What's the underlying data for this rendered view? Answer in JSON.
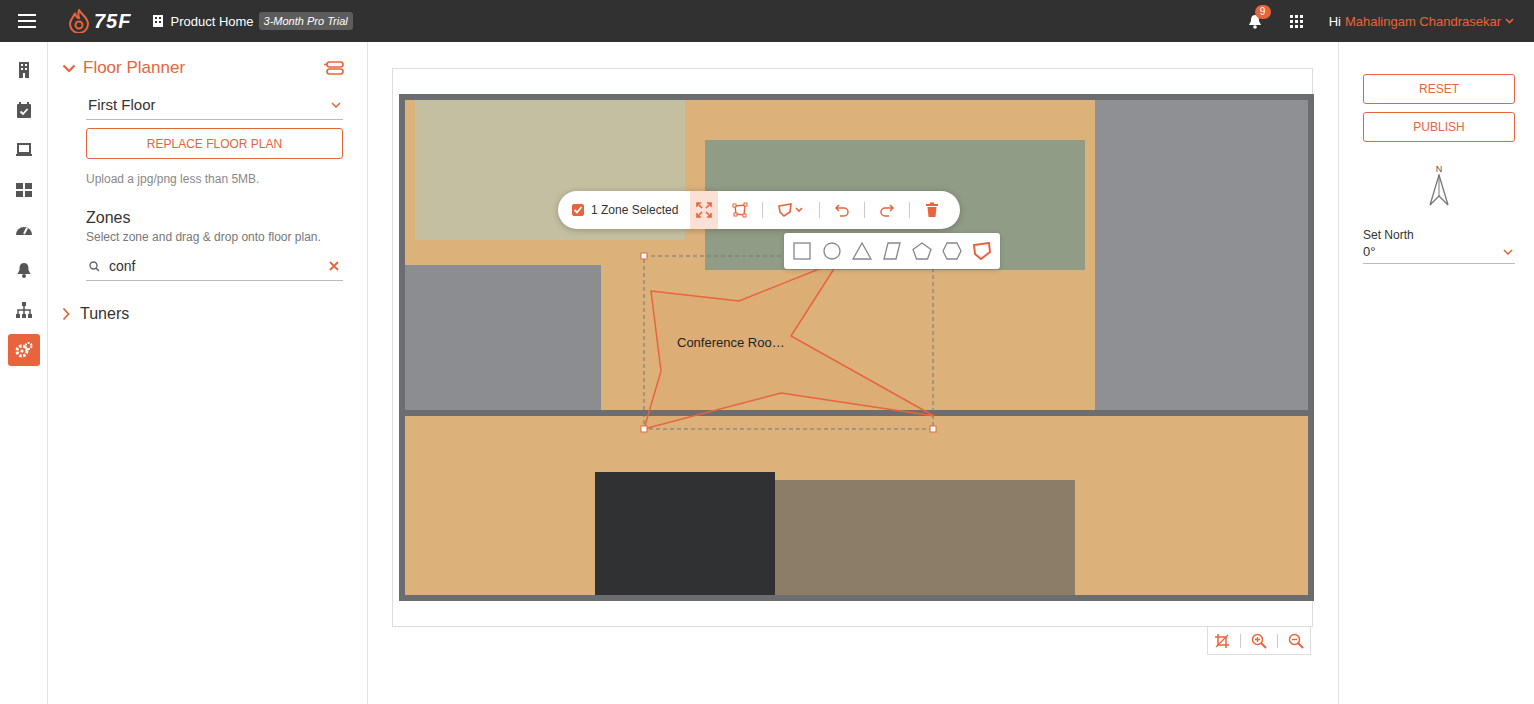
{
  "topbar": {
    "logo": "75F",
    "breadcrumb": "Product Home",
    "trial_badge": "3-Month Pro Trial",
    "notifications": "9",
    "greeting": "Hi",
    "user": "Mahalingam Chandrasekar"
  },
  "rail": [
    {
      "kind": "building",
      "selected": false
    },
    {
      "kind": "calendar",
      "selected": false
    },
    {
      "kind": "device",
      "selected": false
    },
    {
      "kind": "dashboard",
      "selected": false
    },
    {
      "kind": "gauge",
      "selected": false
    },
    {
      "kind": "bell",
      "selected": false
    },
    {
      "kind": "hierarchy",
      "selected": false
    },
    {
      "kind": "settings",
      "selected": true
    }
  ],
  "panel": {
    "title": "Floor Planner",
    "expanded": true,
    "floor": "First Floor",
    "replace_button": "REPLACE FLOOR PLAN",
    "upload_hint": "Upload a jpg/png less than 5MB.",
    "zones_title": "Zones",
    "zones_hint": "Select zone and drag & drop onto floor plan.",
    "search_value": "conf",
    "tuners": {
      "label": "Tuners",
      "expanded": false
    }
  },
  "toolbar": {
    "checked": true,
    "label": "1 Zone Selected",
    "tools": [
      {
        "kind": "fit",
        "selected": true
      },
      {
        "kind": "transform",
        "selected": false
      },
      {
        "kind": "shape",
        "selected": false
      },
      {
        "kind": "undo",
        "selected": false
      },
      {
        "kind": "redo",
        "selected": false
      },
      {
        "kind": "delete",
        "selected": false
      }
    ]
  },
  "shapes": [
    {
      "kind": "square",
      "selected": false
    },
    {
      "kind": "circle",
      "selected": false
    },
    {
      "kind": "triangle",
      "selected": false
    },
    {
      "kind": "parallelogram",
      "selected": false
    },
    {
      "kind": "pentagon",
      "selected": false
    },
    {
      "kind": "hexagon",
      "selected": false
    },
    {
      "kind": "freeform",
      "selected": true
    }
  ],
  "zone": {
    "label": "Conference Roo…",
    "selected": true
  },
  "zoom_tools": [
    {
      "kind": "crop"
    },
    {
      "kind": "zoom-in"
    },
    {
      "kind": "zoom-out"
    }
  ],
  "right": {
    "reset": "RESET",
    "publish": "PUBLISH",
    "north_label": "N",
    "set_north_label": "Set North",
    "set_north_value": "0°"
  }
}
